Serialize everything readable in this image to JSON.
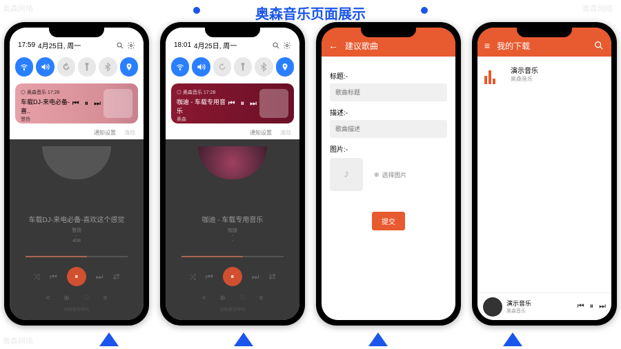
{
  "watermark": "奥森网络",
  "page_title": "奥森音乐页面展示",
  "phones": {
    "p1": {
      "time": "17:59",
      "date": "4月25日, 周一",
      "media_app": "◎ 奥森音乐  17:28",
      "media_title": "车载DJ-来电必备-喜..",
      "media_artist": "慧扬",
      "notif_settings": "通知设置",
      "clear": "清除",
      "dim_title": "车载DJ-来电必备-喜欢这个感觉",
      "dim_artist": "慧扬",
      "dim_album": "-",
      "dim_bitrate": "408",
      "dim_tip": "权限紧急呼叫"
    },
    "p2": {
      "time": "18:01",
      "date": "4月25日, 周一",
      "media_app": "◎ 奥森音乐  17:28",
      "media_title": "咖迪 - 车载专用音乐",
      "media_artist": "奥森",
      "notif_settings": "通知设置",
      "clear": "清除",
      "dim_title": "咖迪 - 车载专用音乐",
      "dim_artist": "咖迪",
      "dim_album": "-",
      "dim_bitrate": "-",
      "dim_tip": "权限紧急呼叫"
    },
    "p3": {
      "bar_title": "建议歌曲",
      "label_title": "标题:-",
      "ph_title": "歌曲标题",
      "label_desc": "描述:-",
      "ph_desc": "歌曲描述",
      "label_img": "图片:-",
      "btn_select_img": "选择图片",
      "btn_submit": "提交"
    },
    "p4": {
      "bar_title": "我的下载",
      "item_title": "演示音乐",
      "item_sub": "奥森音乐",
      "mini_title": "演示音乐",
      "mini_sub": "奥森音乐"
    }
  },
  "icons": {
    "wifi": "wifi",
    "sound": "sound",
    "rotate": "rotate",
    "flash": "flash",
    "bt": "bluetooth",
    "loc": "location",
    "search": "search",
    "gear": "gear",
    "prev": "⏮",
    "pause": "⏸",
    "next": "⏭",
    "back": "←",
    "menu": "≡",
    "plus": "⊕",
    "note": "♪"
  }
}
